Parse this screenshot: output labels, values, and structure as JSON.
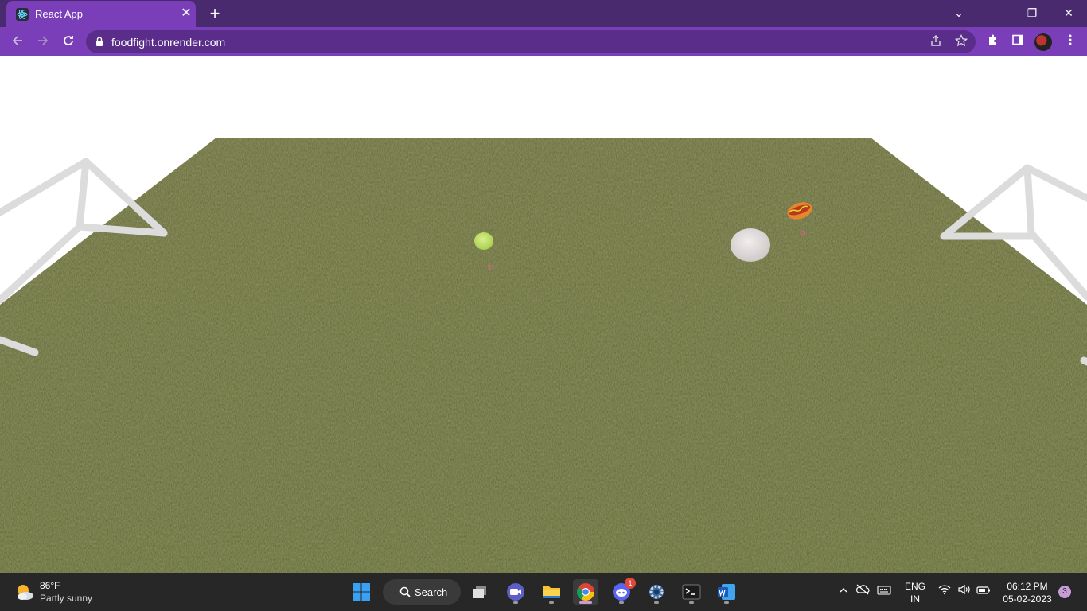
{
  "browser": {
    "tab_title": "React App",
    "tab_close": "✕",
    "new_tab": "+",
    "url": "foodfight.onrender.com",
    "window_controls": {
      "dropdown": "⌄",
      "minimize": "—",
      "restore": "❐",
      "close": "✕"
    },
    "toolbar_icons": [
      "share-icon",
      "star-icon",
      "extensions-icon",
      "side-panel-icon",
      "profile-avatar"
    ]
  },
  "game": {
    "players": [
      {
        "label": "b",
        "item": "lettuce"
      },
      {
        "label": "a",
        "item": "hot-dog"
      }
    ],
    "objects": [
      "tortilla-plate"
    ],
    "colors": {
      "grass": "#5f6e2f",
      "goal_posts": "#dcdcdc",
      "label": "#c86a7a"
    }
  },
  "taskbar": {
    "weather": {
      "temp": "86°F",
      "desc": "Partly sunny"
    },
    "search_label": "Search",
    "apps": [
      {
        "name": "task-view-icon"
      },
      {
        "name": "zoom-icon"
      },
      {
        "name": "file-explorer-icon"
      },
      {
        "name": "chrome-icon",
        "active": true
      },
      {
        "name": "discord-icon",
        "badge": "1"
      },
      {
        "name": "settings-icon"
      },
      {
        "name": "terminal-icon"
      },
      {
        "name": "word-icon"
      }
    ],
    "tray": {
      "lang_line1": "ENG",
      "lang_line2": "IN",
      "time": "06:12 PM",
      "date": "05-02-2023",
      "notifications": "3"
    }
  }
}
